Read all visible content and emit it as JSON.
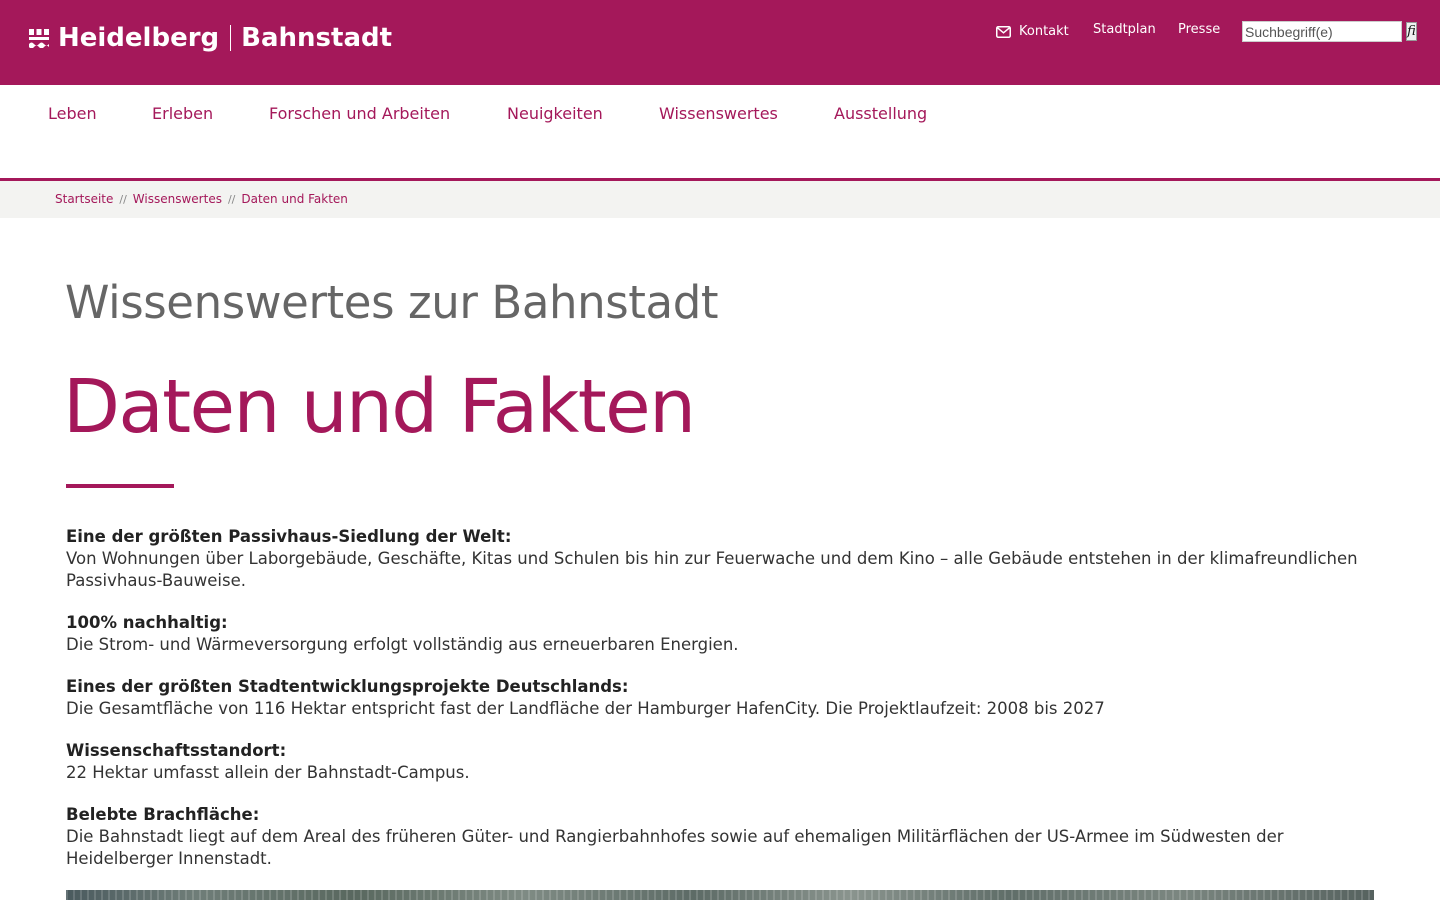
{
  "brand": {
    "city": "Heidelberg",
    "district": "Bahnstadt",
    "color": "#a4185a"
  },
  "utility_nav": {
    "kontakt": "Kontakt",
    "stadtplan": "Stadtplan",
    "presse": "Presse",
    "search_placeholder": "Suchbegriff(e)",
    "search_button": "fi"
  },
  "main_nav": {
    "items": [
      {
        "label": "Leben"
      },
      {
        "label": "Erleben"
      },
      {
        "label": "Forschen und Arbeiten"
      },
      {
        "label": "Neuigkeiten"
      },
      {
        "label": "Wissenswertes"
      },
      {
        "label": "Ausstellung"
      }
    ]
  },
  "breadcrumb": {
    "items": [
      "Startseite",
      "Wissenswertes",
      "Daten und Fakten"
    ],
    "separator": "//"
  },
  "content": {
    "kicker": "Wissenswertes zur Bahnstadt",
    "title": "Daten und Fakten",
    "facts": [
      {
        "heading": "Eine der größten Passivhaus-Siedlung der Welt:",
        "text": "Von Wohnungen über Laborgebäude, Geschäfte, Kitas und Schulen bis hin zur Feuerwache und dem Kino – alle Gebäude entstehen in der klimafreundlichen Passivhaus-Bauweise."
      },
      {
        "heading": "100% nachhaltig:",
        "text": "Die Strom- und Wärmeversorgung erfolgt vollständig aus erneuerbaren Energien."
      },
      {
        "heading": "Eines der größten Stadtentwicklungsprojekte Deutschlands:",
        "text": "Die Gesamtfläche von 116 Hektar entspricht fast der Landfläche der Hamburger HafenCity. Die Projektlaufzeit: 2008 bis 2027"
      },
      {
        "heading": "Wissenschaftsstandort:",
        "text": "22 Hektar umfasst allein der Bahnstadt-Campus."
      },
      {
        "heading": "Belebte Brachfläche:",
        "text": "Die Bahnstadt liegt auf dem Areal des früheren Güter- und Rangierbahnhofes sowie auf ehemaligen Militärflächen der US-Armee im Südwesten der Heidelberger Innenstadt."
      }
    ]
  }
}
